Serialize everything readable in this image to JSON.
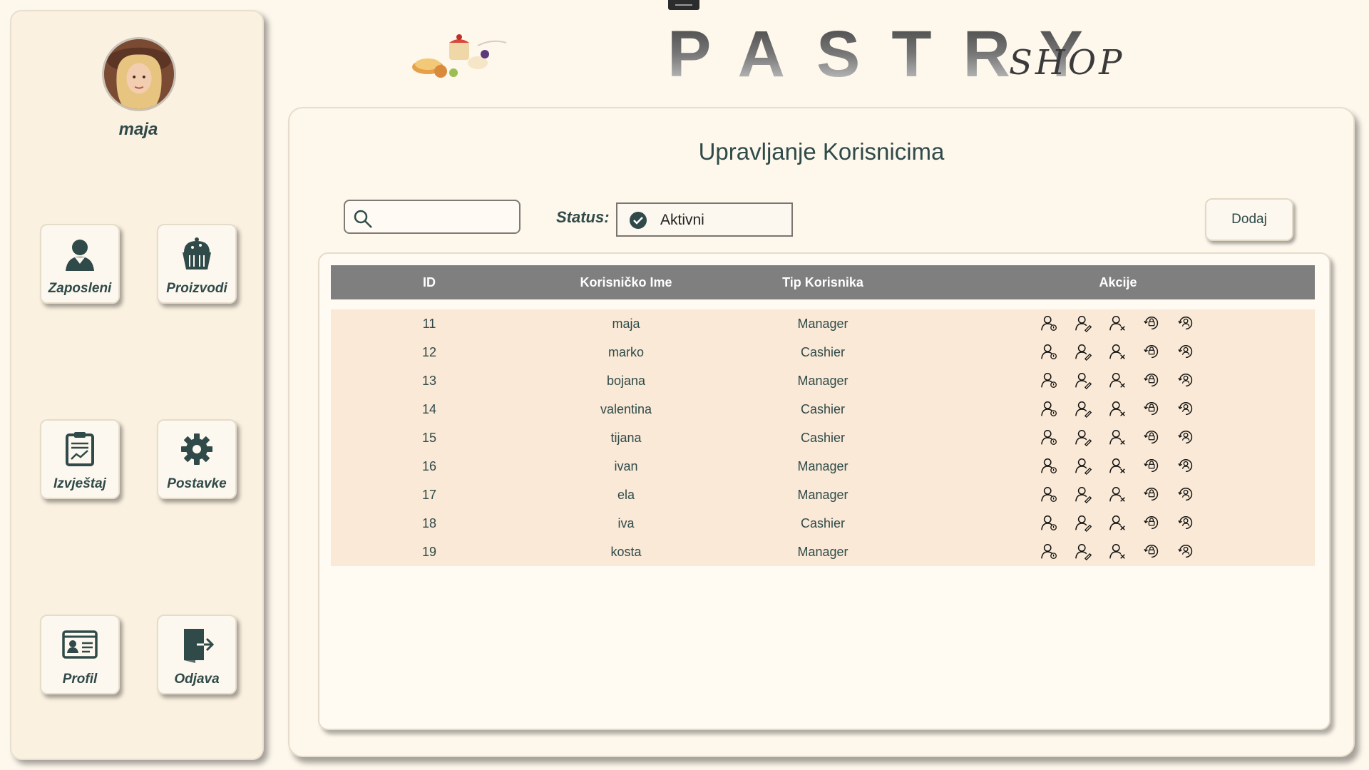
{
  "user": {
    "name": "maja"
  },
  "sidebar": {
    "items": [
      {
        "label": "Zaposleni",
        "icon": "employee-icon"
      },
      {
        "label": "Proizvodi",
        "icon": "cupcake-icon"
      },
      {
        "label": "Izvještaj",
        "icon": "report-icon"
      },
      {
        "label": "Postavke",
        "icon": "gear-icon"
      },
      {
        "label": "Profil",
        "icon": "id-card-icon"
      },
      {
        "label": "Odjava",
        "icon": "logout-icon"
      }
    ]
  },
  "header": {
    "brand": "PASTRY",
    "brand_sub": "SHOP"
  },
  "main": {
    "title": "Upravljanje Korisnicima",
    "search": {
      "value": "",
      "placeholder": ""
    },
    "status": {
      "label": "Status:",
      "value": "Aktivni"
    },
    "add_button": "Dodaj"
  },
  "table": {
    "columns": [
      "ID",
      "Korisničko Ime",
      "Tip Korisnika",
      "Akcije"
    ],
    "rows": [
      {
        "id": "11",
        "username": "maja",
        "type": "Manager"
      },
      {
        "id": "12",
        "username": "marko",
        "type": "Cashier"
      },
      {
        "id": "13",
        "username": "bojana",
        "type": "Manager"
      },
      {
        "id": "14",
        "username": "valentina",
        "type": "Cashier"
      },
      {
        "id": "15",
        "username": "tijana",
        "type": "Cashier"
      },
      {
        "id": "16",
        "username": "ivan",
        "type": "Manager"
      },
      {
        "id": "17",
        "username": "ela",
        "type": "Manager"
      },
      {
        "id": "18",
        "username": "iva",
        "type": "Cashier"
      },
      {
        "id": "19",
        "username": "kosta",
        "type": "Manager"
      }
    ],
    "actions": [
      "user-info-icon",
      "user-edit-icon",
      "user-delete-icon",
      "lock-reset-icon",
      "user-sync-icon"
    ]
  },
  "colors": {
    "accent": "#2f4a49",
    "header_bg": "#807f80",
    "row_bg": "#f9e9d6",
    "page_bg": "#fdf7ec"
  }
}
